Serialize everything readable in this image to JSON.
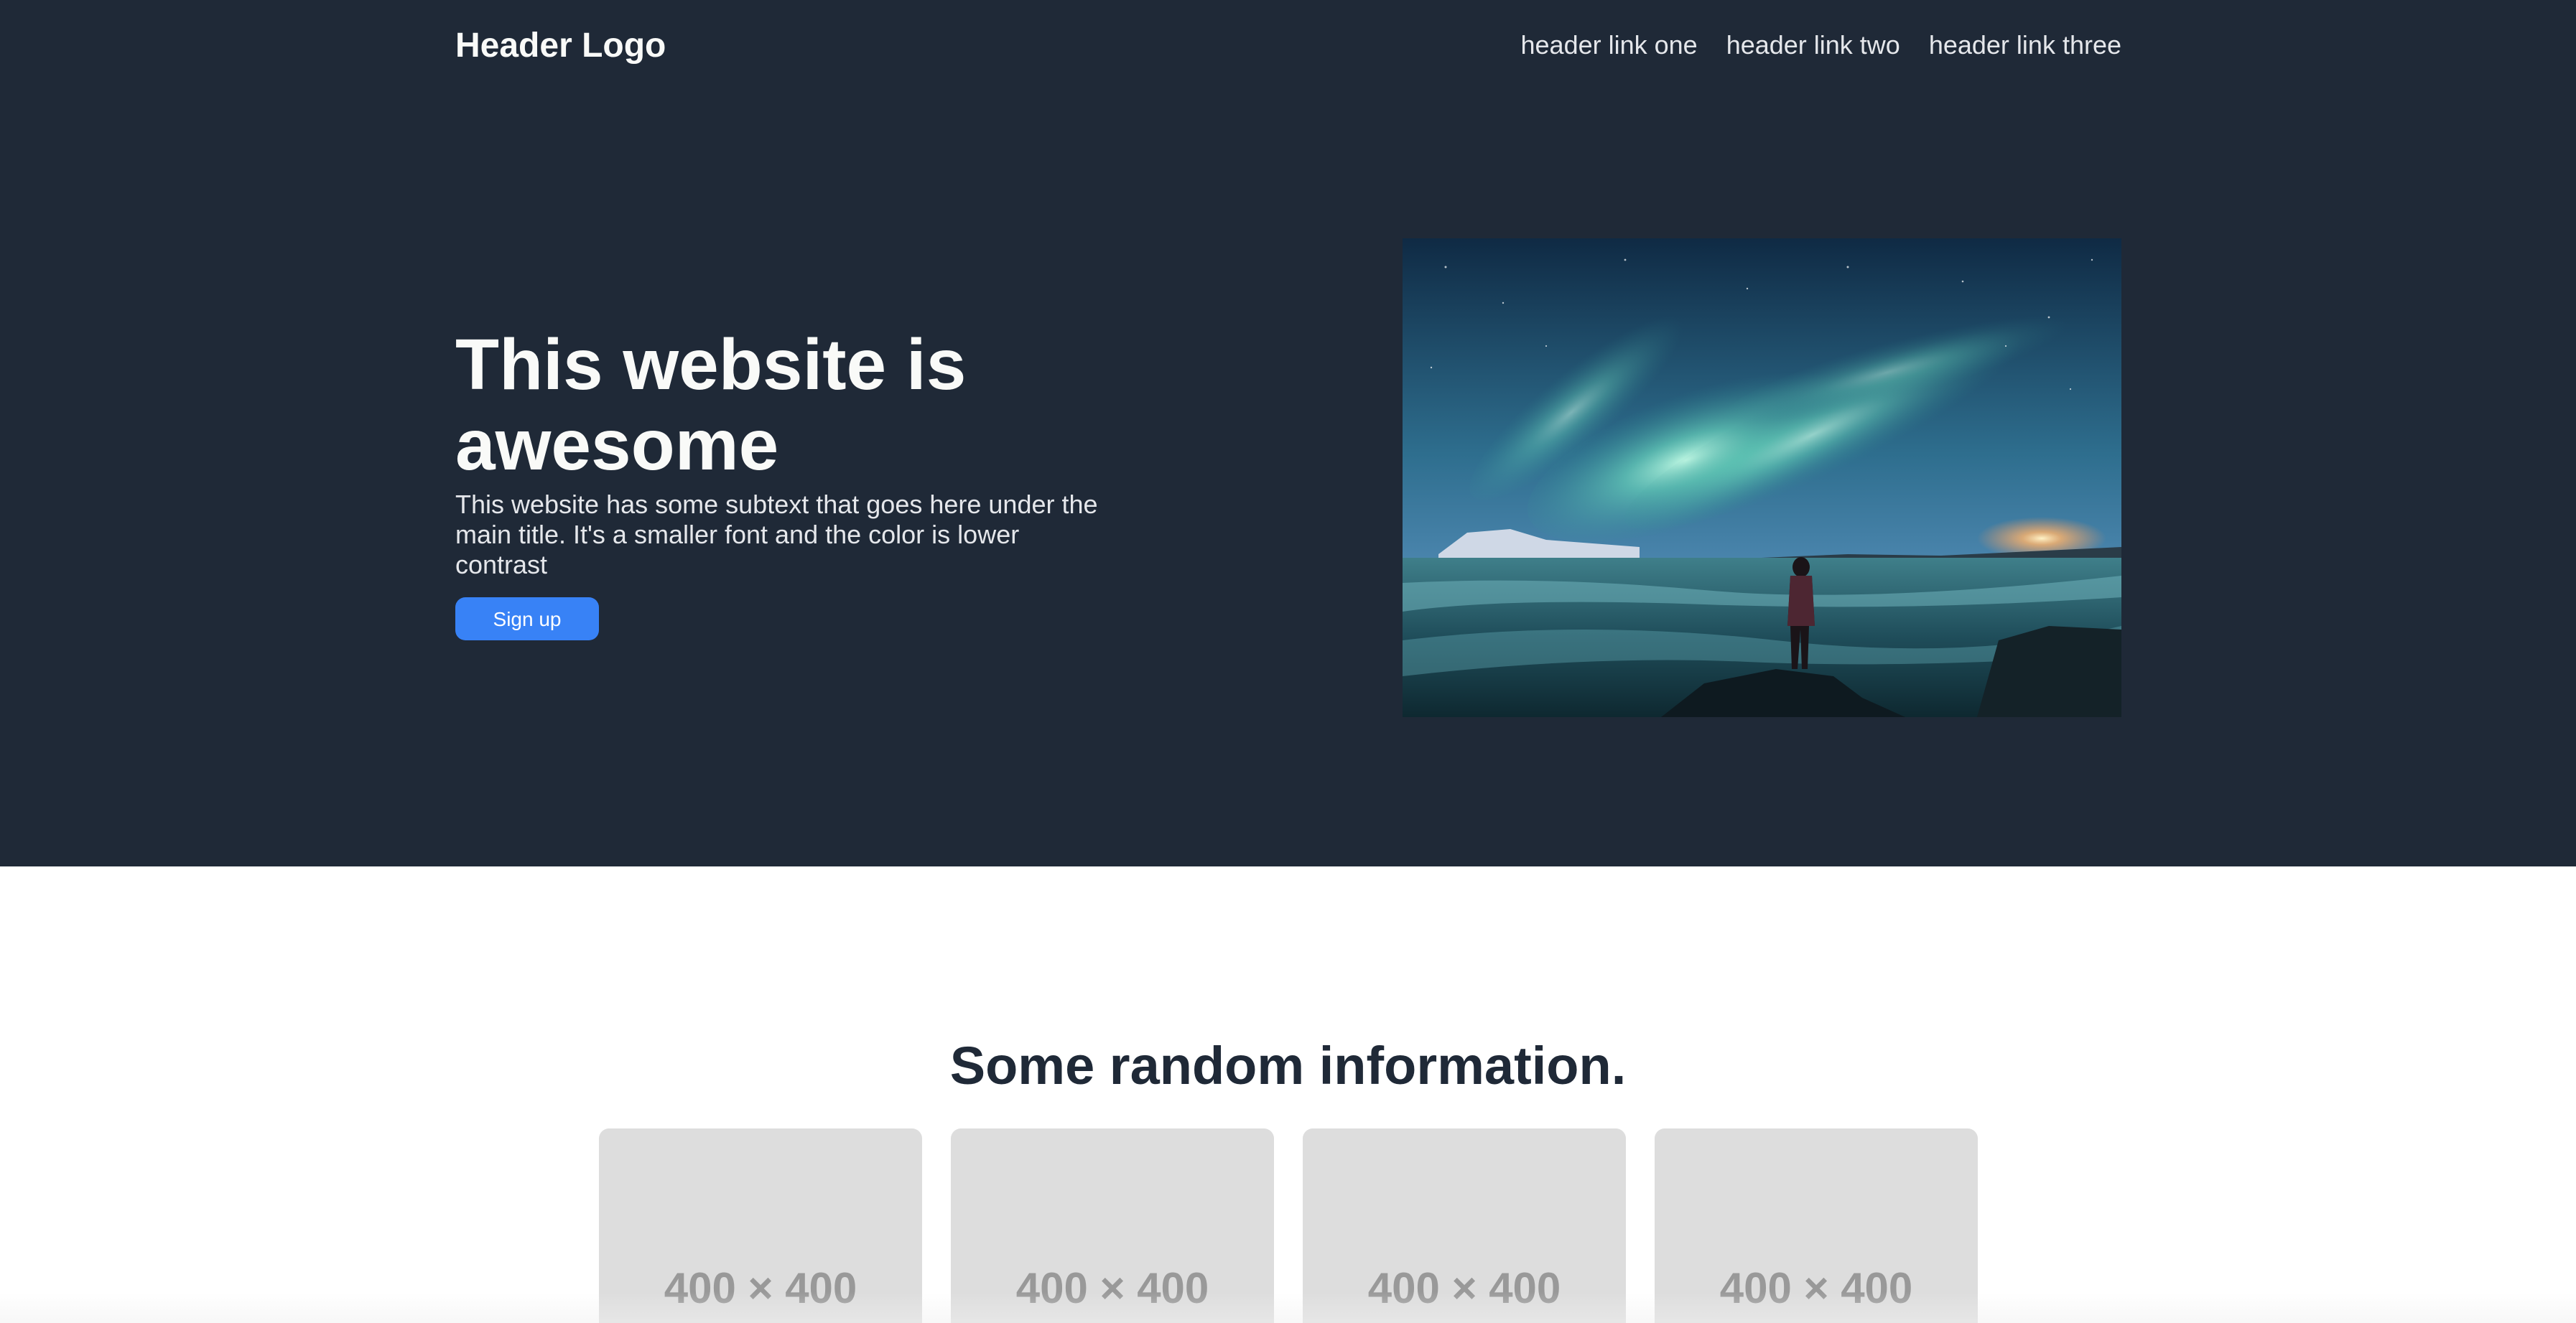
{
  "header": {
    "logo": "Header Logo",
    "links": [
      "header link one",
      "header link two",
      "header link three"
    ]
  },
  "hero": {
    "title": "This website is awesome",
    "subtext": "This website has some subtext that goes here under the main title. It's a smaller font and the color is lower contrast",
    "button_label": "Sign up",
    "image": "aurora-landscape-photo"
  },
  "info": {
    "title": "Some random information.",
    "cards": [
      {
        "label": "400 × 400"
      },
      {
        "label": "400 × 400"
      },
      {
        "label": "400 × 400"
      },
      {
        "label": "400 × 400"
      }
    ]
  },
  "colors": {
    "hero_background": "#1f2937",
    "button": "#3882f6",
    "card": "#dddddd",
    "card_text": "#999999"
  }
}
